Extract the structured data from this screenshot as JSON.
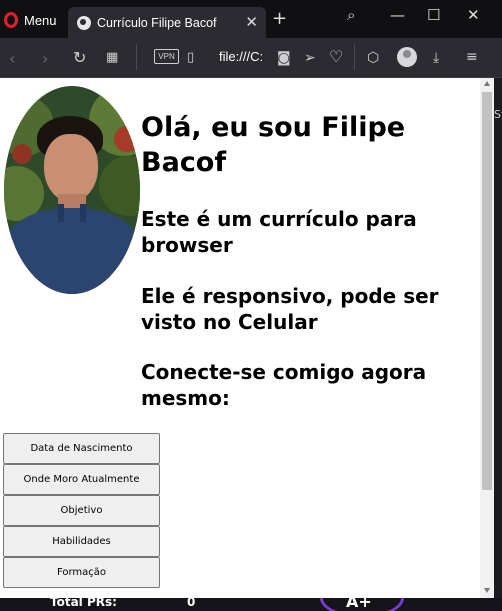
{
  "browser": {
    "menu_label": "Menu",
    "tab_title": "Currículo Filipe Bacof",
    "address": "file:///C:",
    "vpn_label": "VPN"
  },
  "page": {
    "heading": "Olá, eu sou Filipe Bacof",
    "lines": [
      "Este é um currículo para browser",
      "Ele é responsivo, pode ser visto no Celular",
      "Conecte-se comigo agora mesmo:"
    ],
    "buttons": [
      "Data de Nascimento",
      "Onde Moro Atualmente",
      "Objetivo",
      "Habilidades",
      "Formação"
    ]
  },
  "background": {
    "side_text": "St",
    "bottom_label": "Total PRs:",
    "bottom_value": "0",
    "grade": "A+"
  },
  "colors": {
    "opera_red": "#e6202a",
    "chrome_dark": "#2b2b31"
  }
}
